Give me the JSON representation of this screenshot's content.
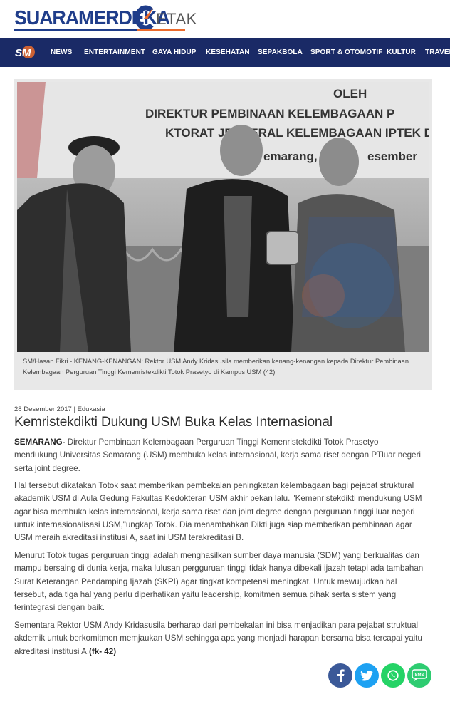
{
  "brand": {
    "name_main": "SUARAMERDEKA",
    "name_suffix": "ETAK",
    "colors": {
      "primary": "#1f3d8a",
      "accent": "#ec6b2c",
      "nav_bg": "#1a2a66"
    }
  },
  "nav": {
    "logo_text": "SM",
    "items": [
      "NEWS",
      "ENTERTAINMENT",
      "GAYA HIDUP",
      "KESEHATAN",
      "SEPAKBOLA",
      "SPORT & OTOMOTIF",
      "KULTUR",
      "TRAVEL"
    ]
  },
  "photo": {
    "banner_lines": [
      "OLEH",
      "DIREKTUR PEMBINAAN KELEMBAGAAN P",
      "KTORAT JENDERAL KELEMBAGAAN IPTEK DA",
      "emarang, ",
      "esember"
    ],
    "caption": "SM/Hasan Fikri - KENANG-KENANGAN: Rektor USM Andy Kridasusila memberikan kenang-kenangan kepada Direktur Pembinaan Kelembagaan Perguruan Tinggi Kemenristekdikti Totok Prasetyo di Kampus USM (42)"
  },
  "article": {
    "date": "28 Desember 2017",
    "separator": "|",
    "category": "Edukasia",
    "title": "Kemristekdikti Dukung USM Buka Kelas Internasional",
    "dateline": "SEMARANG",
    "lead": "- Direktur Pembinaan Kelembagaan Perguruan Tinggi Kemenristekdikti Totok Prasetyo mendukung Universitas Semarang (USM) membuka kelas internasional, kerja sama riset dengan PTluar negeri serta joint degree.",
    "p2": "Hal tersebut dikatakan Totok saat memberikan pembekalan peningkatan kelembagaan bagi pejabat struktural akademik USM di Aula Gedung Fakultas Kedokteran USM akhir pekan lalu. \"Kemenristekdikti mendukung USM agar bisa membuka kelas internasional, kerja sama riset dan joint degree dengan perguruan tinggi luar negeri untuk internasionalisasi USM,\"ungkap Totok. Dia menambahkan Dikti juga siap memberikan pembinaan agar USM meraih akreditasi institusi A, saat ini USM terakreditasi B.",
    "p3": "Menurut Totok tugas perguruan tinggi adalah menghasilkan sumber daya manusia (SDM) yang berkualitas dan mampu bersaing di dunia kerja, maka lulusan pergguruan tinggi tidak hanya dibekali ijazah tetapi ada tambahan Surat Keterangan Pendamping Ijazah (SKPI) agar tingkat kompetensi meningkat. Untuk mewujudkan hal tersebut, ada tiga hal yang perlu diperhatikan yaitu leadership, komitmen semua pihak serta sistem yang terintegrasi dengan baik.",
    "p4": "Sementara Rektor USM Andy Kridasusila berharap dari pembekalan ini bisa menjadikan para pejabat struktual akdemik untuk berkomitmen memjaukan USM sehingga apa yang menjadi harapan bersama bisa tercapai yaitu akreditasi institusi A.",
    "signoff": "(fk- 42)"
  },
  "share": {
    "buttons": [
      {
        "icon": "facebook-icon",
        "color": "#3b5998"
      },
      {
        "icon": "twitter-icon",
        "color": "#1da1f2"
      },
      {
        "icon": "whatsapp-icon",
        "color": "#25d366"
      },
      {
        "icon": "sms-icon",
        "color": "#2ecc71",
        "label": "SMS"
      }
    ]
  }
}
